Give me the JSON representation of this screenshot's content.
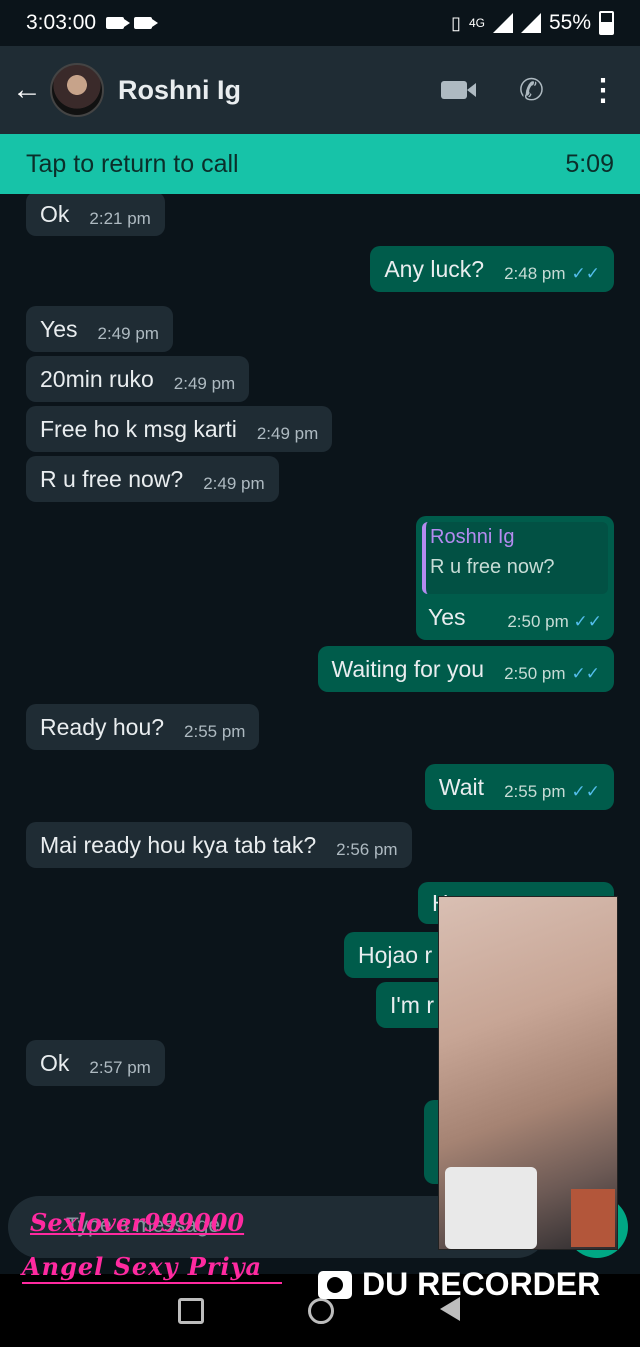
{
  "status_bar": {
    "time": "3:03:00",
    "network": "4G",
    "battery": "55%"
  },
  "app_bar": {
    "contact_name": "Roshni Ig",
    "icons": [
      "back-arrow-icon",
      "video-call-icon",
      "voice-call-icon",
      "more-options-icon"
    ]
  },
  "call_banner": {
    "label": "Tap to return to call",
    "duration": "5:09"
  },
  "messages": [
    {
      "dir": "in",
      "text": "Ok",
      "time": "2:21 pm"
    },
    {
      "dir": "out",
      "text": "Any luck?",
      "time": "2:48 pm"
    },
    {
      "dir": "in",
      "text": "Yes",
      "time": "2:49 pm"
    },
    {
      "dir": "in",
      "text": "20min ruko",
      "time": "2:49 pm"
    },
    {
      "dir": "in",
      "text": "Free ho k msg karti",
      "time": "2:49 pm"
    },
    {
      "dir": "in",
      "text": "R u free now?",
      "time": "2:49 pm"
    },
    {
      "dir": "out",
      "quote_name": "Roshni Ig",
      "quote_text": "R u free now?",
      "text": "Yes",
      "time": "2:50 pm"
    },
    {
      "dir": "out",
      "text": "Waiting for you",
      "time": "2:50 pm"
    },
    {
      "dir": "in",
      "text": "Ready hou?",
      "time": "2:55 pm"
    },
    {
      "dir": "out",
      "text": "Wait",
      "time": "2:55 pm"
    },
    {
      "dir": "in",
      "text": "Mai ready hou kya tab tak?",
      "time": "2:56 pm"
    },
    {
      "dir": "out",
      "text": "H",
      "time": ""
    },
    {
      "dir": "out",
      "text": "Hojao r",
      "time": ""
    },
    {
      "dir": "out",
      "text": "I'm r",
      "time": ""
    },
    {
      "dir": "in",
      "text": "Ok",
      "time": "2:57 pm"
    }
  ],
  "input": {
    "placeholder": "Type a message"
  },
  "watermarks": {
    "line1": "Sexlover999000",
    "line2": "Angel Sexy Priya",
    "recorder": "DU RECORDER"
  },
  "read_tick": "✓✓"
}
